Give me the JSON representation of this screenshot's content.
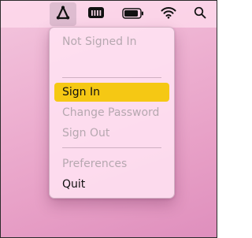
{
  "menubar": {
    "icons": [
      "app-a-icon",
      "battery-percent-icon",
      "battery-icon",
      "wifi-icon",
      "search-icon"
    ]
  },
  "menu": {
    "status": "Not Signed In",
    "sign_in": "Sign In",
    "change_password": "Change Password",
    "sign_out": "Sign Out",
    "preferences": "Preferences",
    "quit": "Quit"
  },
  "colors": {
    "highlight": "#f5c814",
    "disabled_text": "#b6a8b0"
  }
}
